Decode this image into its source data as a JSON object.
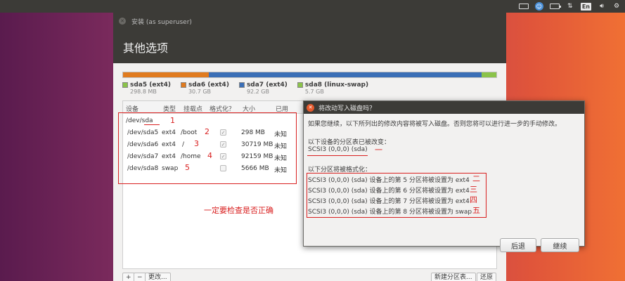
{
  "topbar": {
    "icons": [
      "keyboard-icon",
      "accessibility-icon",
      "battery-icon",
      "network-icon",
      "volume-icon",
      "gear-icon"
    ],
    "lang": "En"
  },
  "window": {
    "title": "安装 (as superuser)",
    "page_title": "其他选项"
  },
  "partitions": {
    "bar": [
      {
        "color": "#e07b1f",
        "fraction": 0.12
      },
      {
        "color": "#e07b1f",
        "fraction": 0.11
      },
      {
        "color": "#3b6fb6",
        "fraction": 0.73
      },
      {
        "color": "#8bc34a",
        "fraction": 0.04
      }
    ],
    "legend": [
      {
        "label": "sda5 (ext4)",
        "size": "298.8 MB",
        "color": "#8bc34a"
      },
      {
        "label": "sda6 (ext4)",
        "size": "30.7 GB",
        "color": "#e07b1f"
      },
      {
        "label": "sda7 (ext4)",
        "size": "92.2 GB",
        "color": "#3b6fb6"
      },
      {
        "label": "sda8 (linux-swap)",
        "size": "5.7 GB",
        "color": "#8bc34a"
      }
    ]
  },
  "table": {
    "headers": [
      "设备",
      "类型",
      "挂载点",
      "格式化？",
      "大小",
      "已用"
    ],
    "root": "/dev/sda",
    "rows": [
      {
        "device": "/dev/sda5",
        "type": "ext4",
        "mount": "/boot",
        "size": "298 MB",
        "used": "未知",
        "mark": "2"
      },
      {
        "device": "/dev/sda6",
        "type": "ext4",
        "mount": "/",
        "size": "30719 MB",
        "used": "未知",
        "mark": "3"
      },
      {
        "device": "/dev/sda7",
        "type": "ext4",
        "mount": "/home",
        "size": "92159 MB",
        "used": "未知",
        "mark": "4"
      },
      {
        "device": "/dev/sda8",
        "type": "swap",
        "mount": "",
        "size": "5666 MB",
        "used": "未知",
        "mark": "5"
      }
    ],
    "root_mark": "1"
  },
  "annotation": {
    "check_note": "一定要检查是否正确",
    "mark_1": "一",
    "marks": [
      "二",
      "三",
      "四",
      "五"
    ]
  },
  "bottom": {
    "plus": "+",
    "minus": "−",
    "change": "更改...",
    "new_table": "新建分区表...",
    "revert": "还原"
  },
  "dialog": {
    "title": "将改动写入磁盘吗？",
    "intro": "如果您继续，以下所列出的修改内容将被写入磁盘。否则您将可以进行进一步的手动修改。",
    "changed_heading": "以下设备的分区表已被改变：",
    "changed_device": "SCSI3 (0,0,0) (sda)",
    "format_heading": "以下分区将被格式化：",
    "format_lines": [
      "SCSI3 (0,0,0) (sda) 设备上的第 5 分区将被设置为 ext4",
      "SCSI3 (0,0,0) (sda) 设备上的第 6 分区将被设置为 ext4",
      "SCSI3 (0,0,0) (sda) 设备上的第 7 分区将被设置为 ext4",
      "SCSI3 (0,0,0) (sda) 设备上的第 8 分区将被设置为 swap"
    ],
    "back_label": "后退",
    "continue_label": "继续"
  }
}
